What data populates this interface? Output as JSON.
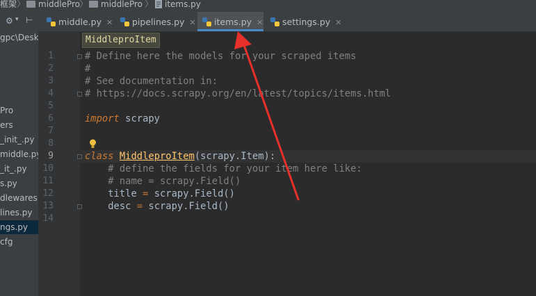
{
  "breadcrumb": {
    "root": "框架",
    "items": [
      "middlePro",
      "middlePro",
      "items.py"
    ]
  },
  "project_panel": {
    "path_fragment": "gpc\\Desk",
    "items": [
      {
        "label": "Pro",
        "selected": false
      },
      {
        "label": "ers",
        "selected": false
      },
      {
        "label": "_init_.py",
        "selected": false
      },
      {
        "label": "middle.py",
        "selected": false
      },
      {
        "label": "_it_.py",
        "selected": false
      },
      {
        "label": "s.py",
        "selected": false
      },
      {
        "label": "dlewares.py",
        "selected": false
      },
      {
        "label": "lines.py",
        "selected": false
      },
      {
        "label": "ngs.py",
        "selected": true
      },
      {
        "label": "cfg",
        "selected": false
      }
    ]
  },
  "tabs": [
    {
      "label": "middle.py",
      "active": false
    },
    {
      "label": "pipelines.py",
      "active": false
    },
    {
      "label": "items.py",
      "active": true
    },
    {
      "label": "settings.py",
      "active": false
    }
  ],
  "structure_hint": "MiddleproItem",
  "line_numbers": [
    "1",
    "2",
    "3",
    "4",
    "5",
    "6",
    "7",
    "8",
    "9",
    "10",
    "11",
    "12",
    "13",
    "14"
  ],
  "code": {
    "l1": "# Define here the models for your scraped items",
    "l2": "#",
    "l3": "# See documentation in:",
    "l4": "# https://docs.scrapy.org/en/latest/topics/items.html",
    "l6_kw": "import",
    "l6_rest": " scrapy",
    "l9_kw": "class",
    "l9_name": "MiddleproItem",
    "l9_rest": "(scrapy.Item):",
    "l10": "    # define the fields for your item here like:",
    "l11": "    # name = scrapy.Field()",
    "l12_a": "    title ",
    "l12_op": "=",
    "l12_b": " scrapy.Field()",
    "l13_a": "    desc ",
    "l13_op": "=",
    "l13_b": " scrapy.Field()"
  },
  "colors": {
    "accent_tab": "#4a88c7",
    "annotation_arrow": "#e8302a"
  }
}
